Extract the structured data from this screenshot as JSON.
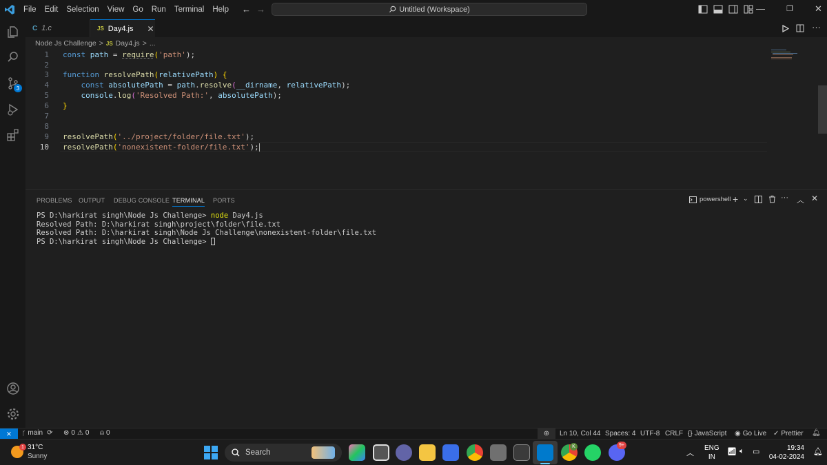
{
  "menu": [
    "File",
    "Edit",
    "Selection",
    "View",
    "Go",
    "Run",
    "Terminal",
    "Help"
  ],
  "command_center": "Untitled (Workspace)",
  "tabs": [
    {
      "icon": "C",
      "label": "1.c"
    },
    {
      "icon": "JS",
      "label": "Day4.js"
    }
  ],
  "breadcrumb": {
    "folder": "Node Js Challenge",
    "icon": "JS",
    "file": "Day4.js",
    "more": "..."
  },
  "code": {
    "line_numbers": [
      "1",
      "2",
      "3",
      "4",
      "5",
      "6",
      "7",
      "8",
      "9",
      "10"
    ],
    "l1": {
      "kw": "const",
      "var": "path",
      "op": " = ",
      "fn": "require",
      "p1": "(",
      "str": "'path'",
      "p2": ");"
    },
    "l3": {
      "kw": "function",
      "fn": "resolvePath",
      "p1": "(",
      "var": "relativePath",
      "p2": ") {"
    },
    "l4": {
      "kw": "const",
      "var": "absolutePath",
      "op": " = ",
      "obj": "path",
      "dot": ".",
      "fn": "resolve",
      "p1": "(",
      "a1": "__dirname",
      "c": ", ",
      "a2": "relativePath",
      "p2": ");"
    },
    "l5": {
      "obj": "console",
      "dot": ".",
      "fn": "log",
      "p1": "(",
      "str": "'Resolved Path:'",
      "c": ", ",
      "var": "absolutePath",
      "p2": ");"
    },
    "l6": "}",
    "l9": {
      "fn": "resolvePath",
      "p1": "(",
      "str": "'../project/folder/file.txt'",
      "p2": ");"
    },
    "l10": {
      "fn": "resolvePath",
      "p1": "(",
      "str": "'nonexistent-folder/file.txt'",
      "p2": ");"
    }
  },
  "panel": {
    "tabs": [
      "PROBLEMS",
      "OUTPUT",
      "DEBUG CONSOLE",
      "TERMINAL",
      "PORTS"
    ],
    "shell": "powershell",
    "terminal_lines": [
      {
        "prompt": "PS D:\\harkirat singh\\Node Js Challenge> ",
        "cmd": "node",
        "arg": " Day4.js"
      },
      {
        "text": "Resolved Path: D:\\harkirat singh\\project\\folder\\file.txt"
      },
      {
        "text": "Resolved Path: D:\\harkirat singh\\Node Js Challenge\\nonexistent-folder\\file.txt"
      },
      {
        "prompt": "PS D:\\harkirat singh\\Node Js Challenge> "
      }
    ]
  },
  "status": {
    "branch": "main",
    "errors": "0",
    "warnings": "0",
    "ports": "0",
    "position": "Ln 10, Col 44",
    "spaces": "Spaces: 4",
    "encoding": "UTF-8",
    "eol": "CRLF",
    "language": "JavaScript",
    "golive": "Go Live",
    "prettier": "Prettier"
  },
  "source_control_badge": "3",
  "taskbar": {
    "weather_temp": "31°C",
    "weather_desc": "Sunny",
    "weather_badge": "1",
    "search": "Search",
    "lang1": "ENG",
    "lang2": "IN",
    "time": "19:34",
    "date": "04-02-2024",
    "discord_badge": "9+",
    "chrome_badge": "K"
  },
  "colors": {
    "accent": "#0078d4",
    "keyword": "#569cd6",
    "function": "#dcdcaa",
    "variable": "#9cdcfe",
    "string": "#ce9178"
  }
}
